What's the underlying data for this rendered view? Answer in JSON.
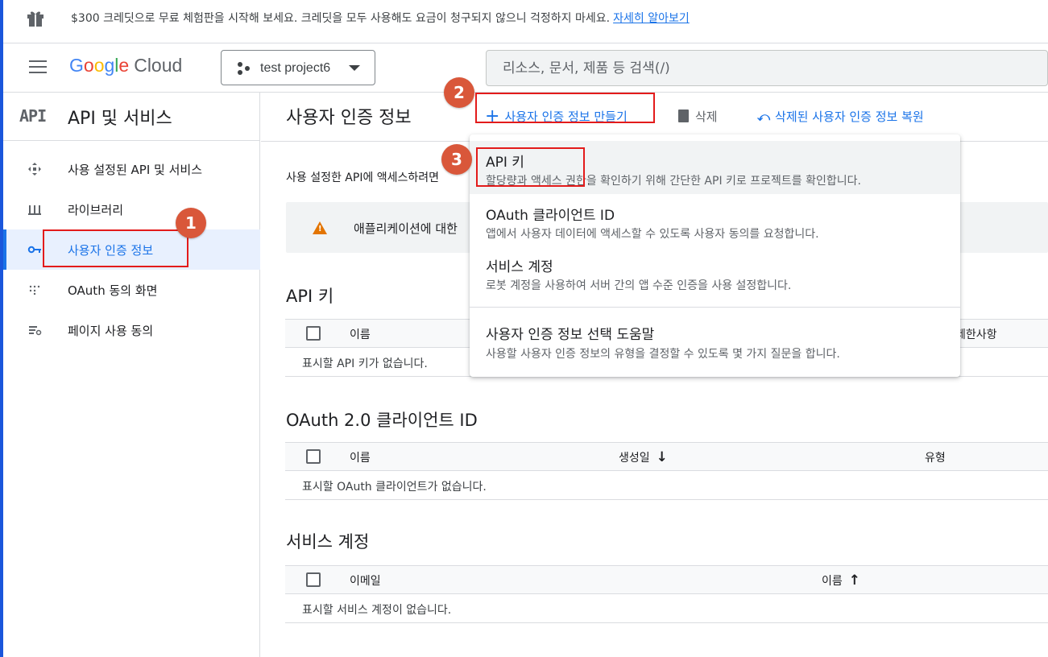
{
  "banner": {
    "text": "$300 크레딧으로 무료 체험판을 시작해 보세요. 크레딧을 모두 사용해도 요금이 청구되지 않으니 걱정하지 마세요.",
    "link": "자세히 알아보기"
  },
  "header": {
    "logo_google": [
      "G",
      "o",
      "o",
      "g",
      "l",
      "e"
    ],
    "logo_cloud": "Cloud",
    "project": "test project6",
    "search_placeholder": "리소스, 문서, 제품 등 검색(/)"
  },
  "sidebar": {
    "badge": "API",
    "title": "API 및 서비스",
    "items": [
      {
        "label": "사용 설정된 API 및 서비스",
        "icon": "diamond-arrows-icon"
      },
      {
        "label": "라이브러리",
        "icon": "library-icon"
      },
      {
        "label": "사용자 인증 정보",
        "icon": "key-icon",
        "active": true
      },
      {
        "label": "OAuth 동의 화면",
        "icon": "dots-grid-icon"
      },
      {
        "label": "페이지 사용 동의",
        "icon": "settings-list-icon"
      }
    ]
  },
  "main": {
    "title": "사용자 인증 정보",
    "toolbar": {
      "create": "사용자 인증 정보 만들기",
      "delete": "삭제",
      "restore": "삭제된 사용자 인증 정보 복원"
    },
    "intro": "사용 설정한 API에 액세스하려면",
    "warning": "애플리케이션에 대한"
  },
  "api_keys": {
    "title": "API 키",
    "col_name": "이름",
    "col_restrictions": "제한사항",
    "empty": "표시할 API 키가 없습니다."
  },
  "oauth": {
    "title": "OAuth 2.0 클라이언트 ID",
    "col_name": "이름",
    "col_created": "생성일",
    "col_type": "유형",
    "empty": "표시할 OAuth 클라이언트가 없습니다."
  },
  "service_accounts": {
    "title": "서비스 계정",
    "col_email": "이메일",
    "col_name": "이름",
    "empty": "표시할 서비스 계정이 없습니다."
  },
  "menu": {
    "items": [
      {
        "title": "API 키",
        "desc": "할당량과 액세스 권한을 확인하기 위해 간단한 API 키로 프로젝트를 확인합니다."
      },
      {
        "title": "OAuth 클라이언트 ID",
        "desc": "앱에서 사용자 데이터에 액세스할 수 있도록 사용자 동의를 요청합니다."
      },
      {
        "title": "서비스 계정",
        "desc": "로봇 계정을 사용하여 서버 간의 앱 수준 인증을 사용 설정합니다."
      },
      {
        "title": "사용자 인증 정보 선택 도움말",
        "desc": "사용할 사용자 인증 정보의 유형을 결정할 수 있도록 몇 가지 질문을 합니다."
      }
    ]
  },
  "annotations": {
    "steps": [
      "1",
      "2",
      "3"
    ],
    "color": "#e31b1b",
    "badge_color": "#d9573a"
  },
  "colors": {
    "accent": "#1a73e8",
    "warning": "#e37400"
  }
}
